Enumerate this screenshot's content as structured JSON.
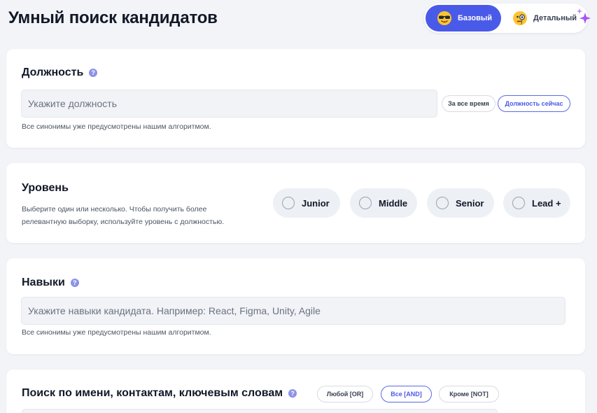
{
  "page": {
    "title": "Умный поиск кандидатов"
  },
  "mode_switch": {
    "basic_label": "Базовый",
    "basic_icon": "sunglasses-emoji-icon",
    "detailed_label": "Детальный",
    "detailed_icon": "monocle-emoji-icon",
    "accent": "#4a5ae8"
  },
  "position_card": {
    "title": "Должность",
    "input_placeholder": "Укажите должность",
    "input_value": "",
    "hint": "Все синонимы уже предусмотрены нашим алгоритмом.",
    "options": [
      {
        "label": "За все время",
        "selected": false
      },
      {
        "label": "Должность сейчас",
        "selected": true
      }
    ]
  },
  "level_card": {
    "title": "Уровень",
    "hint": "Выберите один или несколько. Чтобы получить более релевантную выборку, используйте уровень с должностью.",
    "levels": [
      {
        "label": "Junior",
        "checked": false
      },
      {
        "label": "Middle",
        "checked": false
      },
      {
        "label": "Senior",
        "checked": false
      },
      {
        "label": "Lead +",
        "checked": false
      }
    ]
  },
  "skills_card": {
    "title": "Навыки",
    "input_placeholder": "Укажите навыки кандидата. Например: React, Figma, Unity, Agile",
    "input_value": "",
    "hint": "Все синонимы уже предусмотрены нашим алгоритмом."
  },
  "keyword_card": {
    "title": "Поиск по имени, контактам, ключевым словам",
    "operators": [
      {
        "label": "Любой [OR]",
        "selected": false
      },
      {
        "label": "Все [AND]",
        "selected": true
      },
      {
        "label": "Кроме [NOT]",
        "selected": false
      }
    ]
  }
}
